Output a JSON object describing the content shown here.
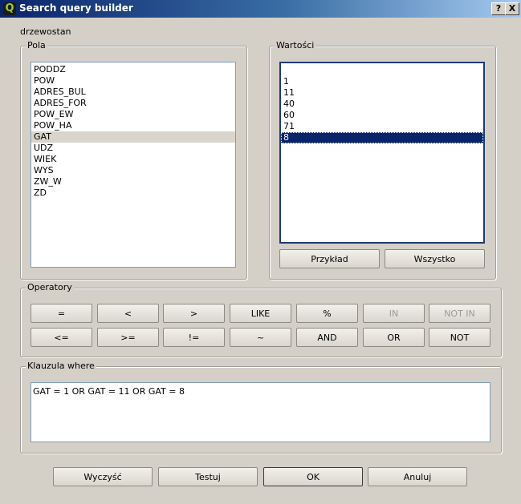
{
  "window": {
    "title": "Search query builder",
    "help_button": "?",
    "close_button": "X"
  },
  "layer_name": "drzewostan",
  "fields": {
    "title": "Pola",
    "items": [
      "PODDZ",
      "POW",
      "ADRES_BUL",
      "ADRES_FOR",
      "POW_EW",
      "POW_HA",
      "GAT",
      "UDZ",
      "WIEK",
      "WYS",
      "ZW_W",
      "ZD"
    ],
    "selected": "GAT"
  },
  "values": {
    "title": "Wartości",
    "items": [
      "",
      "1",
      "11",
      "40",
      "60",
      "71",
      "8"
    ],
    "selected": "8",
    "sample_button": "Przykład",
    "all_button": "Wszystko"
  },
  "operators": {
    "title": "Operatory",
    "row1": [
      "=",
      "<",
      ">",
      "LIKE",
      "%",
      "IN",
      "NOT IN"
    ],
    "row2": [
      "<=",
      ">=",
      "!=",
      "~",
      "AND",
      "OR",
      "NOT"
    ],
    "disabled": [
      "IN",
      "NOT IN"
    ]
  },
  "where_clause": {
    "title": "Klauzula where",
    "text": "GAT = 1 OR GAT = 11 OR GAT = 8"
  },
  "footer": {
    "clear_button": "Wyczyść",
    "test_button": "Testuj",
    "ok_button": "OK",
    "cancel_button": "Anuluj"
  }
}
